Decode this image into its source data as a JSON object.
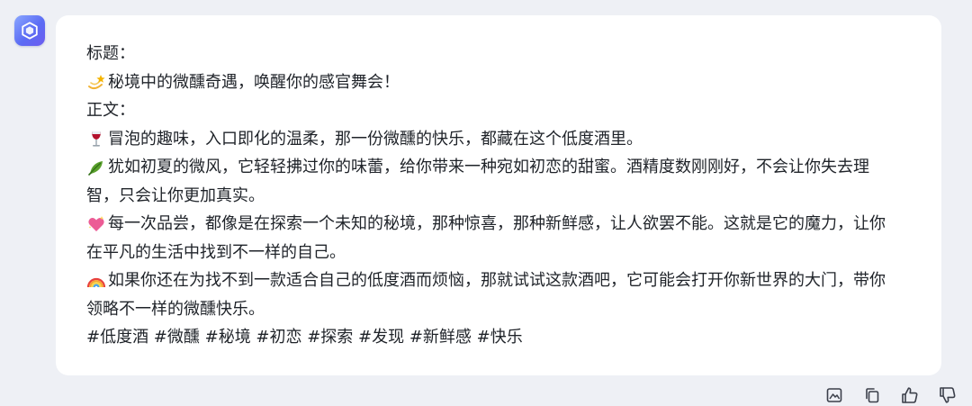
{
  "assistant": {
    "avatar_icon": "cube-icon",
    "accent": "#5b6cf4"
  },
  "message": {
    "title_label": "标题：",
    "title_text": "秘境中的微醺奇遇，唤醒你的感官舞会！",
    "title_emoji": "dizzy-star",
    "body_label": "正文：",
    "paragraphs": [
      {
        "emoji": "wine-glass",
        "lines": [
          "冒泡的趣味，入口即化的温柔，那一份微醺的快乐，都藏在这个低度酒里。"
        ]
      },
      {
        "emoji": "herb-leaf",
        "lines": [
          "犹如初夏的微风，它轻轻拂过你的味蕾，给你带来一种宛如初恋的甜蜜。酒精度数刚刚好，不会让你失去理",
          "智，只会让你更加真实。"
        ]
      },
      {
        "emoji": "sparkling-heart",
        "lines": [
          "每一次品尝，都像是在探索一个未知的秘境，那种惊喜，那种新鲜感，让人欲罢不能。这就是它的魔力，让你",
          "在平凡的生活中找到不一样的自己。"
        ]
      },
      {
        "emoji": "rainbow",
        "lines": [
          "如果你还在为找不到一款适合自己的低度酒而烦恼，那就试试这款酒吧，它可能会打开你新世界的大门，带你",
          "领略不一样的微醺快乐。"
        ]
      }
    ],
    "hashtags": "#低度酒 #微醺 #秘境 #初恋 #探索 #发现 #新鲜感 #快乐"
  },
  "toolbar": {
    "items": [
      "image-icon",
      "copy-icon",
      "thumbs-up-icon",
      "thumbs-down-icon"
    ]
  }
}
